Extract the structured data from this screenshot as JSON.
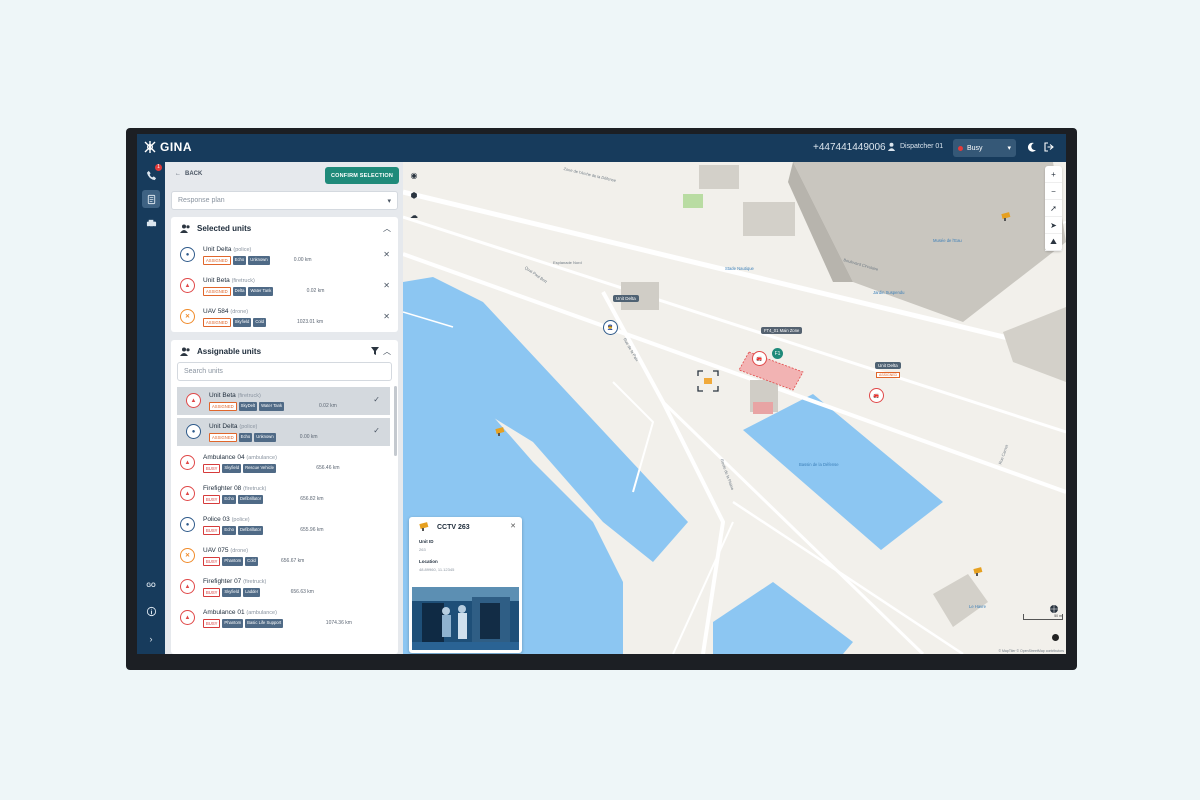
{
  "app": {
    "name": "GINA"
  },
  "topbar": {
    "phone": "+447441449006",
    "user": "Dispatcher 01",
    "status": "Busy"
  },
  "rail": {
    "call_badge": "1",
    "bottom_label": "GO"
  },
  "panel": {
    "back_label": "BACK",
    "confirm_label": "CONFIRM SELECTION",
    "plan_placeholder": "Response plan",
    "selected_title": "Selected units",
    "selected": [
      {
        "name": "Unit Delta",
        "type": "(police)",
        "color": "blue",
        "tags": [
          "ASSIGNED",
          "Echo",
          "Unknown"
        ],
        "distance": "0.00 km"
      },
      {
        "name": "Unit Beta",
        "type": "(firetruck)",
        "color": "red",
        "tags": [
          "ASSIGNED",
          "Delta",
          "Water Tank"
        ],
        "distance": "0.02 km"
      },
      {
        "name": "UAV 584",
        "type": "(drone)",
        "color": "orange",
        "tags": [
          "ASSIGNED",
          "Skyfield",
          "Cold"
        ],
        "distance": "1023.01 km"
      }
    ],
    "assignable_title": "Assignable units",
    "search_placeholder": "Search units",
    "assignable": [
      {
        "name": "Unit Beta",
        "type": "(firetruck)",
        "color": "red",
        "tags": [
          "ASSIGNED",
          "SkyDelt",
          "Water Tank"
        ],
        "distance": "0.02 km",
        "selected": true
      },
      {
        "name": "Unit Delta",
        "type": "(police)",
        "color": "blue",
        "tags": [
          "ASSIGNED",
          "Echo",
          "Unknown"
        ],
        "distance": "0.00 km",
        "selected": true
      },
      {
        "name": "Ambulance 04",
        "type": "(ambulance)",
        "color": "red",
        "tags": [
          "BUSY",
          "Skyfield",
          "Rescue Vehicle"
        ],
        "distance": "656.46 km",
        "selected": false
      },
      {
        "name": "Firefighter 08",
        "type": "(firetruck)",
        "color": "red",
        "tags": [
          "BUSY",
          "Echo",
          "Defibrillator"
        ],
        "distance": "656.82 km",
        "selected": false
      },
      {
        "name": "Police 03",
        "type": "(police)",
        "color": "blue",
        "tags": [
          "BUSY",
          "Echo",
          "Defibrillator"
        ],
        "distance": "655.96 km",
        "selected": false
      },
      {
        "name": "UAV 075",
        "type": "(drone)",
        "color": "orange",
        "tags": [
          "BUSY",
          "Phantom",
          "Cold"
        ],
        "distance": "656.67 km",
        "selected": false
      },
      {
        "name": "Firefighter 07",
        "type": "(firetruck)",
        "color": "red",
        "tags": [
          "BUSY",
          "Skyfield",
          "Ladder"
        ],
        "distance": "656.63 km",
        "selected": false
      },
      {
        "name": "Ambulance 01",
        "type": "(ambulance)",
        "color": "red",
        "tags": [
          "BUSY",
          "Phantom",
          "Basic Life Support"
        ],
        "distance": "1074.36 km",
        "selected": false
      }
    ]
  },
  "map": {
    "labels": [
      {
        "text": "Zone de l'Arche de la Défense"
      },
      {
        "text": "Esplanade Nord"
      },
      {
        "text": "Quai Paul Bert"
      },
      {
        "text": "Boulevard Circulaire"
      },
      {
        "text": "Rue de la Paix"
      },
      {
        "text": "Route de la Plaine"
      },
      {
        "text": "Rue Carnot"
      }
    ],
    "pois": [
      "Stade Nautique",
      "Musée de l'Eau",
      "Jardin Suspendu",
      "Bassin de la Défense",
      "Le Havre"
    ],
    "unit_pins": [
      {
        "label": "Unit Delta",
        "badge": "",
        "color": "blue"
      },
      {
        "label": "Unit Beta",
        "badge": "ASSIGNED",
        "color": "red"
      },
      {
        "label": "Unit Delta",
        "badge": "",
        "color": "red"
      }
    ],
    "zone_label": "FT4_01 Main Zone",
    "green_pin_text": "F1",
    "scale_text": "50 m",
    "attribution": "© MapTiler © OpenStreetMap contributors"
  },
  "cctv": {
    "title": "CCTV 263",
    "unit_id_label": "Unit ID",
    "unit_id_value": "263",
    "location_label": "Location",
    "location_value": "48.89960, 11.12345"
  }
}
